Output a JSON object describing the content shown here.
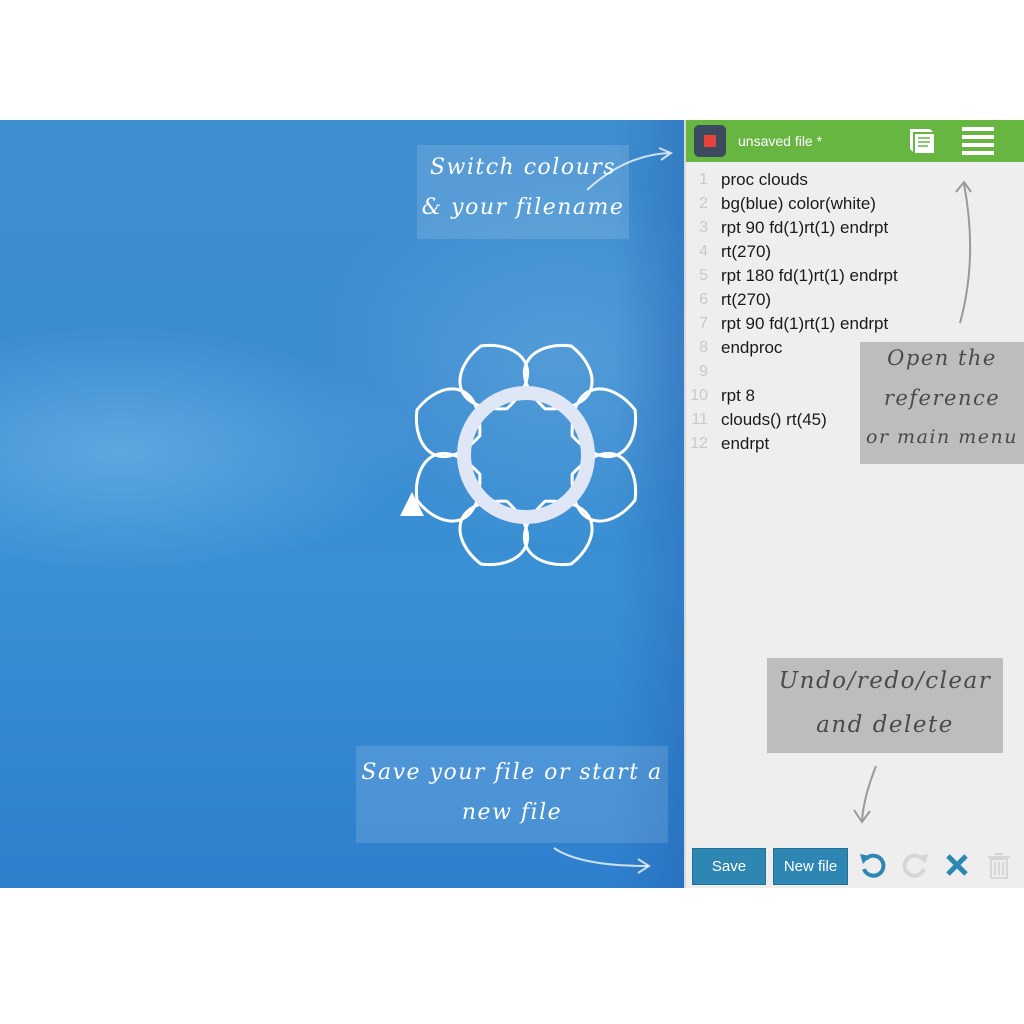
{
  "canvas": {
    "hints": {
      "colours": [
        "Switch colours",
        "& your filename"
      ],
      "save": [
        "Save your file or start a",
        "new file"
      ]
    }
  },
  "editor": {
    "filename": "unsaved file *",
    "code_lines": [
      {
        "n": "1",
        "text": "proc clouds"
      },
      {
        "n": "2",
        "text": "bg(blue) color(white)"
      },
      {
        "n": "3",
        "text": "rpt 90 fd(1)rt(1) endrpt"
      },
      {
        "n": "4",
        "text": "rt(270)"
      },
      {
        "n": "5",
        "text": "rpt 180 fd(1)rt(1) endrpt"
      },
      {
        "n": "6",
        "text": "rt(270)"
      },
      {
        "n": "7",
        "text": "rpt 90 fd(1)rt(1) endrpt"
      },
      {
        "n": "8",
        "text": "endproc"
      },
      {
        "n": "9",
        "text": ""
      },
      {
        "n": "10",
        "text": "rpt 8"
      },
      {
        "n": "11",
        "text": "clouds() rt(45)"
      },
      {
        "n": "12",
        "text": "endrpt"
      }
    ],
    "hints": {
      "reference": [
        "Open the",
        "reference",
        "or main menu"
      ],
      "undo": [
        "Undo/redo/clear",
        "and delete"
      ]
    },
    "buttons": {
      "save_label": "Save",
      "new_file_label": "New file"
    }
  },
  "colors": {
    "topbar": "#67b642",
    "button": "#2e87b2",
    "swatch_red": "#e8423c",
    "canvas_blue": "#3b8bd0"
  },
  "icons": [
    "book-icon",
    "menu-icon",
    "undo-icon",
    "redo-icon",
    "clear-icon",
    "trash-icon"
  ]
}
